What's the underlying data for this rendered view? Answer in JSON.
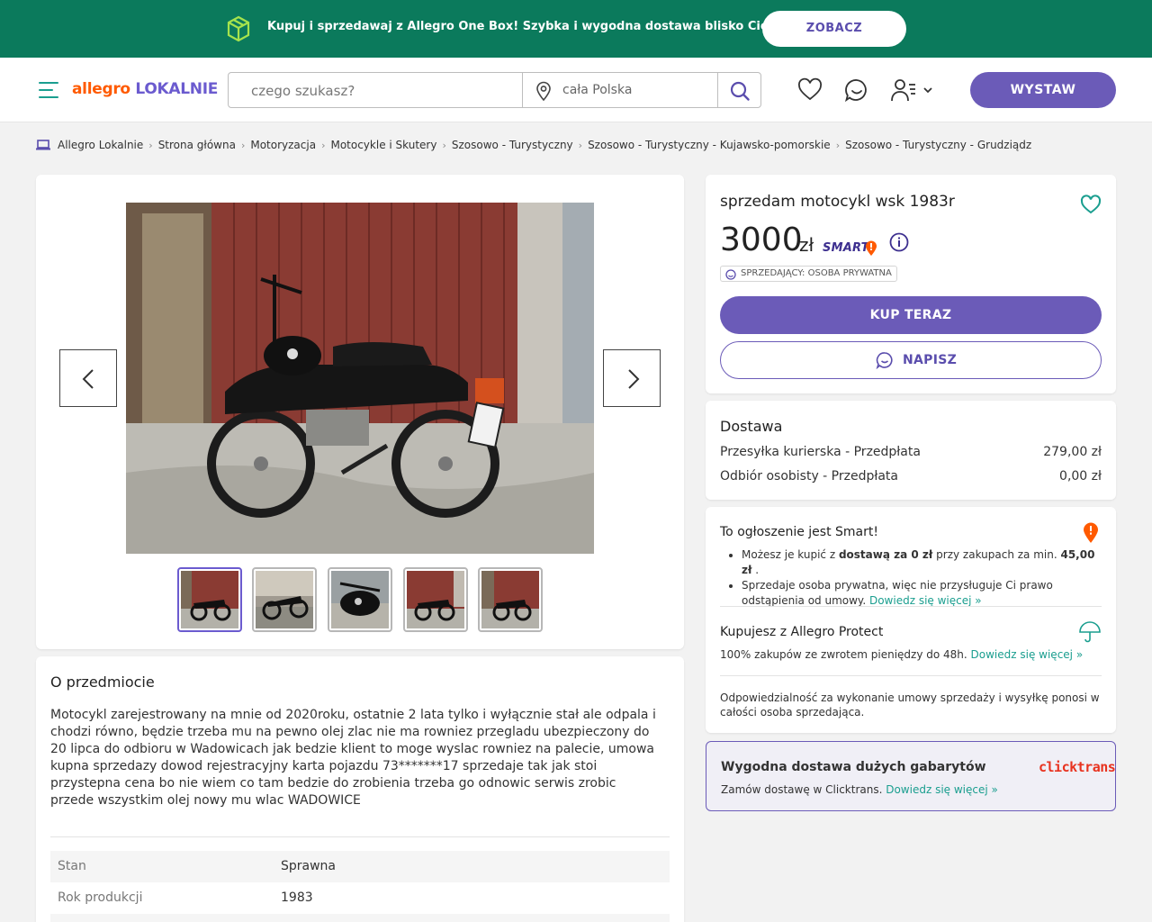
{
  "promo": {
    "text": "Kupuj i sprzedawaj z Allegro One Box! Szybka i wygodna dostawa blisko Ciebie",
    "button": "ZOBACZ",
    "icon": "box-icon"
  },
  "header": {
    "logo_a": "allegro",
    "logo_b": "LOKALNIE",
    "search_placeholder": "czego szukasz?",
    "location": "cała Polska",
    "sell_button": "WYSTAW",
    "icons": [
      "menu-icon",
      "search-icon",
      "heart-icon",
      "chat-icon",
      "user-icon",
      "chevron-down-icon"
    ]
  },
  "breadcrumb": [
    "Allegro Lokalnie",
    "Strona główna",
    "Motoryzacja",
    "Motocykle i Skutery",
    "Szosowo - Turystyczny",
    "Szosowo - Turystyczny - Kujawsko-pomorskie",
    "Szosowo - Turystyczny - Grudziądz"
  ],
  "gallery": {
    "thumbnail_count": 5,
    "selected_index": 0
  },
  "listing": {
    "title": "sprzedam motocykl wsk 1983r",
    "price": "3000",
    "currency": "zł",
    "smart_label": "SMART",
    "seller_badge": "SPRZEDAJĄCY: OSOBA PRYWATNA",
    "buy_button": "KUP TERAZ",
    "message_button": "NAPISZ"
  },
  "delivery": {
    "heading": "Dostawa",
    "options": [
      {
        "name": "Przesyłka kurierska - Przedpłata",
        "price": "279,00 zł"
      },
      {
        "name": "Odbiór osobisty - Przedpłata",
        "price": "0,00 zł"
      }
    ]
  },
  "smart": {
    "heading": "To ogłoszenie jest Smart!",
    "b1_pre": "Możesz je kupić z ",
    "b1_bold1": "dostawą za 0 zł",
    "b1_mid": " przy zakupach za min. ",
    "b1_bold2": "45,00 zł",
    "b1_post": " .",
    "b2_text": "Sprzedaje osoba prywatna, więc nie przysługuje Ci prawo odstąpienia od umowy. ",
    "b2_link": "Dowiedz się więcej »",
    "protect_heading": "Kupujesz z Allegro Protect",
    "protect_text": "100% zakupów ze zwrotem pieniędzy do 48h. ",
    "protect_link": "Dowiedz się więcej »",
    "responsibility": "Odpowiedzialność za wykonanie umowy sprzedaży i wysyłkę ponosi w całości osoba sprzedająca."
  },
  "oversize": {
    "heading": "Wygodna dostawa dużych gabarytów",
    "text": "Zamów dostawę w Clicktrans. ",
    "link": "Dowiedz się więcej »",
    "brand": "clicktrans"
  },
  "about": {
    "heading": "O przedmiocie",
    "description": "Motocykl zarejestrowany na mnie od 2020roku, ostatnie 2 lata tylko i wyłącznie stał ale odpala i chodzi równo, będzie trzeba mu na pewno olej zlac nie ma rowniez przegladu ubezpieczony do 20 lipca do odbioru w Wadowicach jak bedzie klient to moge wyslac rowniez na palecie, umowa kupna sprzedazy dowod rejestracyjny karta pojazdu 73*******17 sprzedaje tak jak stoi przystepna cena bo nie wiem co tam bedzie do zrobienia trzeba go odnowic serwis zrobic przede wszystkim olej nowy mu wlac WADOWICE",
    "params": [
      {
        "key": "Stan",
        "value": "Sprawna"
      },
      {
        "key": "Rok produkcji",
        "value": "1983"
      }
    ]
  },
  "colors": {
    "promo_bg": "#0b7a5c",
    "accent": "#6b5bb8",
    "link": "#1a9e8f",
    "orange": "#ff5a00"
  }
}
